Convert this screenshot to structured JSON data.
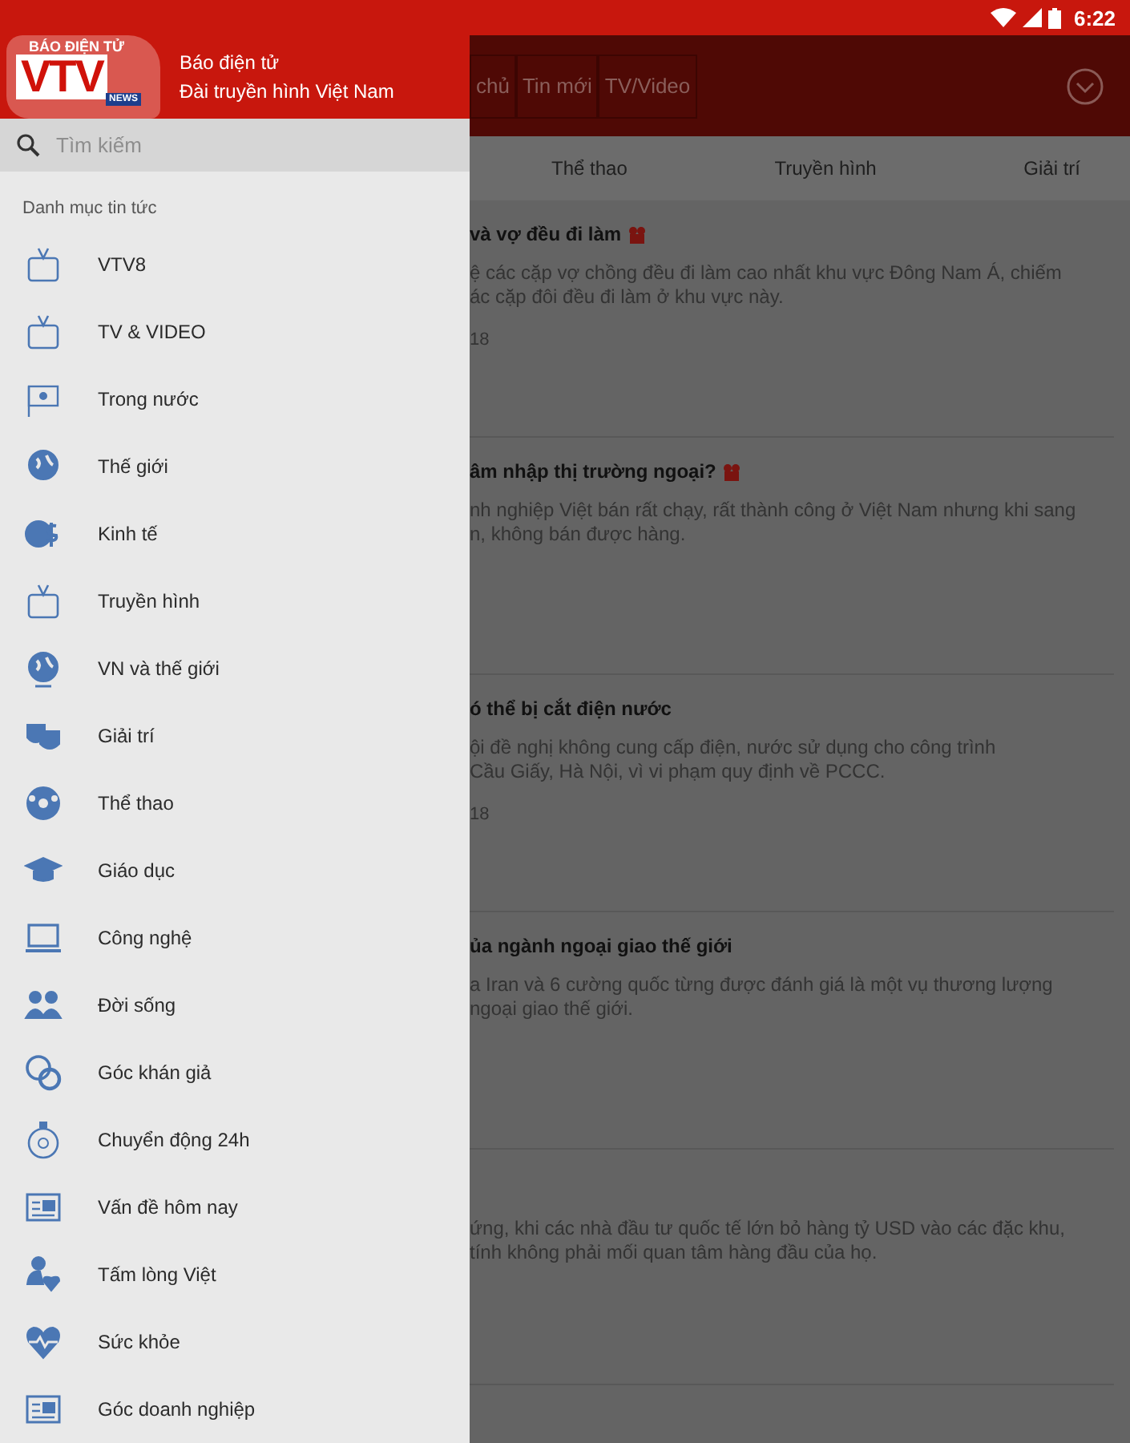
{
  "status_bar": {
    "time": "6:22"
  },
  "drawer": {
    "logo": {
      "top": "BÁO ĐIỆN TỬ",
      "main": "VTV",
      "badge": "NEWS"
    },
    "title": "Báo điện tử",
    "subtitle": "Đài truyền hình Việt Nam",
    "search": {
      "placeholder": "Tìm kiếm"
    },
    "section": "Danh mục tin tức",
    "items": [
      {
        "label": "VTV8"
      },
      {
        "label": "TV & VIDEO"
      },
      {
        "label": "Trong nước"
      },
      {
        "label": "Thế giới"
      },
      {
        "label": "Kinh tế"
      },
      {
        "label": "Truyền hình"
      },
      {
        "label": "VN và thế giới"
      },
      {
        "label": "Giải trí"
      },
      {
        "label": "Thể thao"
      },
      {
        "label": "Giáo dục"
      },
      {
        "label": "Công nghệ"
      },
      {
        "label": "Đời sống"
      },
      {
        "label": "Góc khán giả"
      },
      {
        "label": "Chuyển động 24h"
      },
      {
        "label": "Vấn đề hôm nay"
      },
      {
        "label": "Tấm lòng Việt"
      },
      {
        "label": "Sức khỏe"
      },
      {
        "label": "Góc doanh nghiệp"
      }
    ]
  },
  "app_bar": {
    "tabs": [
      {
        "label": "chủ"
      },
      {
        "label": "Tin mới"
      },
      {
        "label": "TV/Video"
      }
    ]
  },
  "categories": [
    {
      "label": "Thể thao"
    },
    {
      "label": "Truyền hình"
    },
    {
      "label": "Giải trí"
    }
  ],
  "articles": [
    {
      "title": "và vợ đều đi làm",
      "video": true,
      "lines": [
        "ệ các cặp vợ chồng đều đi làm cao nhất khu vực Đông Nam Á, chiếm",
        "ác cặp đôi đều đi làm ở khu vực này."
      ],
      "date": "18"
    },
    {
      "title": "âm nhập thị trường ngoại?",
      "video": true,
      "lines": [
        "nh nghiệp Việt bán rất chạy, rất thành công ở Việt Nam nhưng khi sang",
        "n, không bán được hàng."
      ]
    },
    {
      "title": "ó thể bị cắt điện nước",
      "video": false,
      "lines": [
        "ội đề nghị không cung cấp điện, nước sử dụng cho công trình",
        "Cầu Giấy, Hà Nội, vì vi phạm quy định về PCCC."
      ],
      "date": "18"
    },
    {
      "title": "ủa ngành ngoại giao thế giới",
      "video": false,
      "lines": [
        "a Iran và 6 cường quốc từng được đánh giá là một vụ thương lượng",
        "ngoại giao thế giới."
      ]
    },
    {
      "video": false,
      "lines": [
        "ứng, khi các nhà đầu tư quốc tế lớn bỏ hàng tỷ USD vào các đặc khu,",
        "tính không phải mối quan tâm hàng đầu của họ."
      ]
    }
  ]
}
